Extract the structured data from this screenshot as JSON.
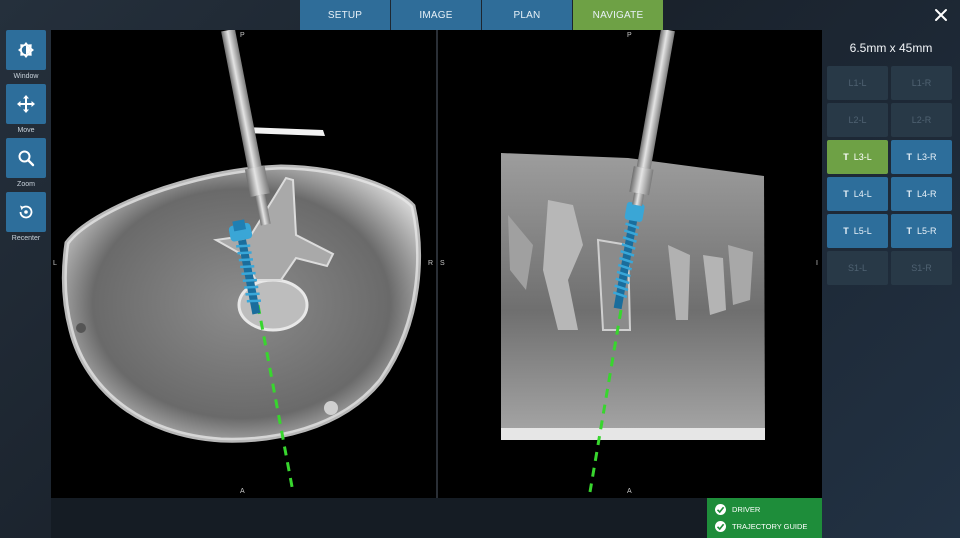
{
  "nav": {
    "tabs": [
      {
        "label": "SETUP",
        "active": false
      },
      {
        "label": "IMAGE",
        "active": false
      },
      {
        "label": "PLAN",
        "active": false
      },
      {
        "label": "NAVIGATE",
        "active": true
      }
    ],
    "close_icon": "close-icon"
  },
  "toolbar": {
    "tools": [
      {
        "label": "Window",
        "icon": "contrast-icon"
      },
      {
        "label": "Move",
        "icon": "move-arrows-icon"
      },
      {
        "label": "Zoom",
        "icon": "magnifier-icon"
      },
      {
        "label": "Recenter",
        "icon": "recenter-icon"
      }
    ]
  },
  "views": {
    "axial": {
      "top": "P",
      "bottom": "A",
      "left": "L",
      "right": "R"
    },
    "sagittal": {
      "top": "P",
      "bottom": "A",
      "left": "S",
      "right": "I"
    }
  },
  "status": {
    "items": [
      "DRIVER",
      "TRAJECTORY GUIDE"
    ],
    "color": "#1e8d3a"
  },
  "panel": {
    "screw_size": "6.5mm x 45mm",
    "levels": [
      {
        "label": "L1-L",
        "state": "disabled"
      },
      {
        "label": "L1-R",
        "state": "disabled"
      },
      {
        "label": "L2-L",
        "state": "disabled"
      },
      {
        "label": "L2-R",
        "state": "disabled"
      },
      {
        "label": "L3-L",
        "state": "selected"
      },
      {
        "label": "L3-R",
        "state": "enabled"
      },
      {
        "label": "L4-L",
        "state": "enabled"
      },
      {
        "label": "L4-R",
        "state": "enabled"
      },
      {
        "label": "L5-L",
        "state": "enabled"
      },
      {
        "label": "L5-R",
        "state": "enabled"
      },
      {
        "label": "S1-L",
        "state": "disabled"
      },
      {
        "label": "S1-R",
        "state": "disabled"
      }
    ],
    "accent": "#6ea145",
    "primary": "#2d6e9b"
  }
}
